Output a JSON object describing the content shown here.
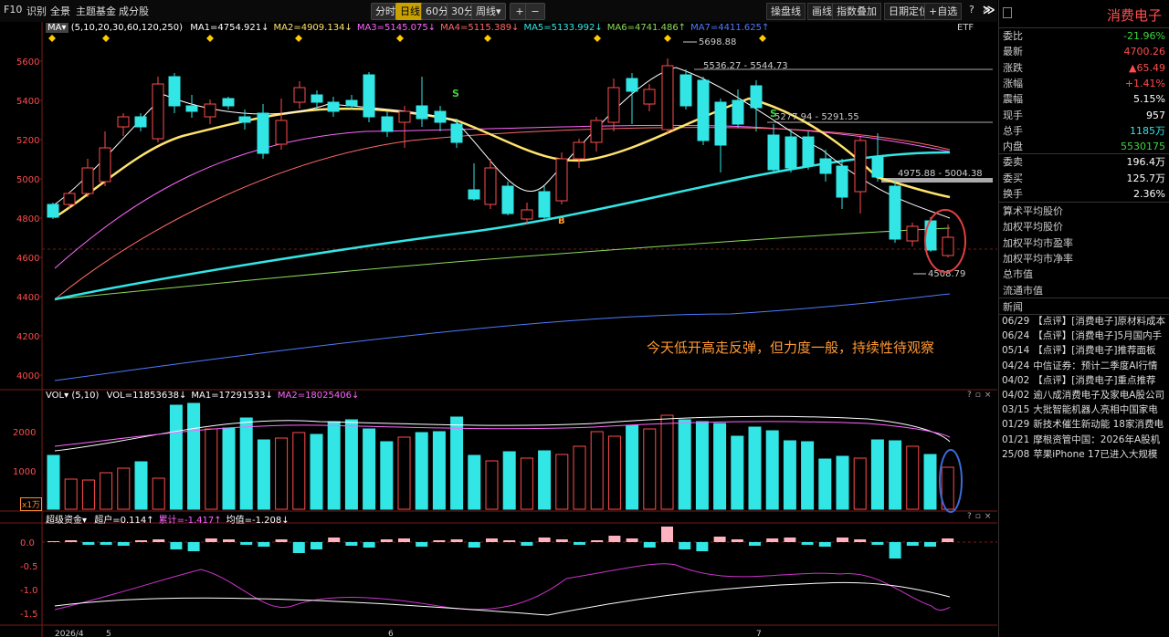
{
  "toolbar": {
    "left_items": [
      "F10",
      "识别",
      "全景",
      "主题基金",
      "成分股"
    ],
    "periods": [
      "分时",
      "日线",
      "60分",
      "30分",
      "周线"
    ],
    "active_period": "日线",
    "period_dropdown": "▾",
    "zoom_plus": "+",
    "zoom_minus": "−",
    "right_items": [
      "操盘线",
      "画线",
      "指数叠加",
      "日期定位",
      "+自选"
    ],
    "icons": [
      "?",
      "✕",
      "≫"
    ]
  },
  "ma_legend": {
    "prefix": "MA▾",
    "params": "(5,10,20,30,60,120,250)",
    "items": [
      {
        "label": "MA1=4754.921↓",
        "color": "#ffffff"
      },
      {
        "label": "MA2=4909.134↓",
        "color": "#ffe36e"
      },
      {
        "label": "MA3=5145.075↓",
        "color": "#ff66ff"
      },
      {
        "label": "MA4=5115.389↓",
        "color": "#ff6a6a"
      },
      {
        "label": "MA5=5133.992↓",
        "color": "#33e6e6"
      },
      {
        "label": "MA6=4741.486↑",
        "color": "#8cdc5a"
      },
      {
        "label": "MA7=4411.625↑",
        "color": "#4d7cff"
      }
    ],
    "etf_tag": "ETF"
  },
  "price_axis": {
    "labels": [
      "5600",
      "5400",
      "5200",
      "5000",
      "4800",
      "4600",
      "4400",
      "4200",
      "4000"
    ]
  },
  "annotations": {
    "high": "5698.88",
    "range1": "5536.27 - 5544.73",
    "range2": "5277.94 - 5291.55",
    "range3": "4975.88 - 5004.38",
    "low": "4508.79",
    "comment": "今天低开高走反弹，但力度一般，持续性待观察",
    "sell_mark": "S",
    "buy_mark": "B"
  },
  "vol_legend": {
    "prefix": "VOL▾",
    "params": "(5,10)",
    "items": [
      {
        "label": "VOL=11853638↓",
        "color": "#ffffff"
      },
      {
        "label": "MA1=17291533↓",
        "color": "#ffffff"
      },
      {
        "label": "MA2=18025406↓",
        "color": "#ff66ff"
      }
    ],
    "axis": [
      "2000",
      "1000"
    ],
    "unit": "x1万"
  },
  "fund_legend": {
    "prefix": "超级资金▾",
    "items": [
      {
        "label": "超户=0.114↑",
        "color": "#ffffff"
      },
      {
        "label": "累计=-1.417↑",
        "color": "#ff66ff"
      },
      {
        "label": "均值=-1.208↓",
        "color": "#ffffff"
      }
    ],
    "axis": [
      "0.0",
      "-0.5",
      "-1.0",
      "-1.5"
    ]
  },
  "date_axis": [
    "2026/4",
    "5",
    "6",
    "7"
  ],
  "panel_icons": [
    "?",
    "▫",
    "×"
  ],
  "right_panel": {
    "title": "消费电子",
    "rows": [
      {
        "k": "委比",
        "v": "-21.96%",
        "c": "#3dd63d"
      },
      {
        "k": "最新",
        "v": "4700.26",
        "c": "#ff4d4d"
      },
      {
        "k": "涨跌",
        "v": "▲65.49",
        "c": "#ff4d4d"
      },
      {
        "k": "涨幅",
        "v": "+1.41%",
        "c": "#ff4d4d"
      },
      {
        "k": "震幅",
        "v": "5.15%",
        "c": "#ffffff"
      },
      {
        "k": "现手",
        "v": "957",
        "c": "#ffffff"
      },
      {
        "k": "总手",
        "v": "1185万",
        "c": "#33e6e6"
      },
      {
        "k": "内盘",
        "v": "5530175",
        "c": "#3dd63d"
      },
      {
        "k": "委卖",
        "v": "196.4万",
        "c": "#ffffff"
      },
      {
        "k": "委买",
        "v": "125.7万",
        "c": "#ffffff"
      },
      {
        "k": "换手",
        "v": "2.36%",
        "c": "#ffffff"
      }
    ],
    "labels": [
      "算术平均股价",
      "加权平均股价",
      "加权平均市盈率",
      "加权平均市净率",
      "总市值",
      "流通市值"
    ],
    "news_title": "新闻",
    "news": [
      {
        "d": "06/29",
        "t": "【点评】[消费电子]原材料成本"
      },
      {
        "d": "06/24",
        "t": "【点评】[消费电子]5月国内手"
      },
      {
        "d": "05/14",
        "t": "【点评】[消费电子]推荐面板"
      },
      {
        "d": "04/24",
        "t": "中信证券：预计二季度AI行情"
      },
      {
        "d": "04/02",
        "t": "【点评】[消费电子]重点推荐"
      },
      {
        "d": "04/02",
        "t": "逾八成消费电子及家电A股公司"
      },
      {
        "d": "03/15",
        "t": "大批智能机器人亮相中国家电"
      },
      {
        "d": "01/29",
        "t": "新技术催生新动能 18家消费电"
      },
      {
        "d": "01/21",
        "t": "摩根资管中国：2026年A股机"
      },
      {
        "d": "25/08",
        "t": "苹果iPhone 17已进入大规模"
      }
    ]
  },
  "colors": {
    "up": "#ff4d4d",
    "down": "#33e6e6",
    "grid": "#7a1a1a",
    "accent": "#c8a000"
  }
}
